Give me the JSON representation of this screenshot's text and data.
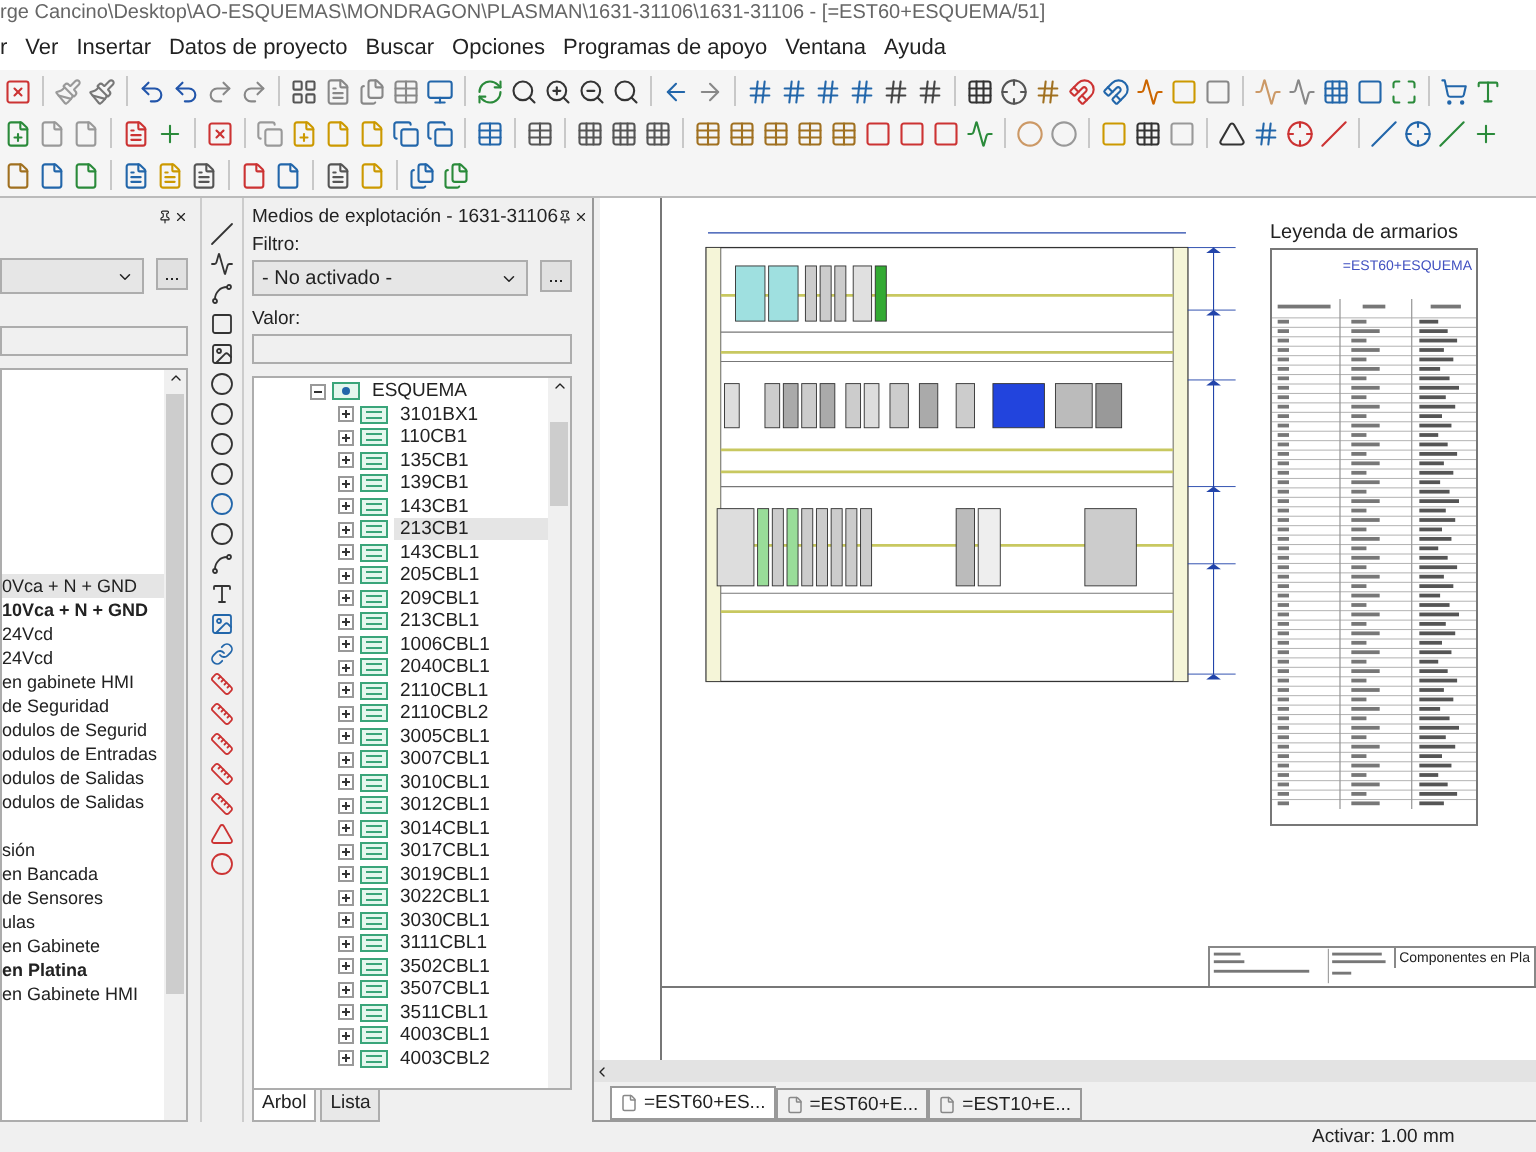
{
  "window": {
    "title": "rge Cancino\\Desktop\\AO-ESQUEMAS\\MONDRAGON\\PLASMAN\\1631-31106\\1631-31106 - [=EST60+ESQUEMA/51]"
  },
  "menu": [
    "r",
    "Ver",
    "Insertar",
    "Datos de proyecto",
    "Buscar",
    "Opciones",
    "Programas de apoyo",
    "Ventana",
    "Ayuda"
  ],
  "left_panel": {
    "browse_button": "...",
    "items": [
      {
        "label": "0Vca + N + GND",
        "emphasized": false,
        "selected": true
      },
      {
        "label": "10Vca + N + GND",
        "emphasized": true,
        "selected": false
      },
      {
        "label": "24Vcd",
        "emphasized": false,
        "selected": false
      },
      {
        "label": "24Vcd",
        "emphasized": false,
        "selected": false
      },
      {
        "label": "en gabinete HMI",
        "emphasized": false,
        "selected": false
      },
      {
        "label": "de Seguridad",
        "emphasized": false,
        "selected": false
      },
      {
        "label": "odulos de Segurid",
        "emphasized": false,
        "selected": false
      },
      {
        "label": "odulos de Entradas",
        "emphasized": false,
        "selected": false
      },
      {
        "label": "odulos de Salidas",
        "emphasized": false,
        "selected": false
      },
      {
        "label": "odulos de Salidas",
        "emphasized": false,
        "selected": false
      },
      {
        "label": "sión",
        "emphasized": false,
        "selected": false
      },
      {
        "label": "en Bancada",
        "emphasized": false,
        "selected": false
      },
      {
        "label": "de Sensores",
        "emphasized": false,
        "selected": false
      },
      {
        "label": "ulas",
        "emphasized": false,
        "selected": false
      },
      {
        "label": "en Gabinete",
        "emphasized": false,
        "selected": false
      },
      {
        "label": "en Platina",
        "emphasized": true,
        "selected": false
      },
      {
        "label": "en Gabinete HMI",
        "emphasized": false,
        "selected": false
      }
    ]
  },
  "middle_panel": {
    "title": "Medios de explotación - 1631-31106",
    "filter_label": "Filtro:",
    "filter_value": "- No activado -",
    "browse_button": "...",
    "value_label": "Valor:",
    "tree": {
      "label": "ESQUEMA",
      "expanded": true,
      "children": [
        {
          "label": "3101BX1",
          "selected": false
        },
        {
          "label": "110CB1",
          "selected": false
        },
        {
          "label": "135CB1",
          "selected": false
        },
        {
          "label": "139CB1",
          "selected": false
        },
        {
          "label": "143CB1",
          "selected": false
        },
        {
          "label": "213CB1",
          "selected": true
        },
        {
          "label": "143CBL1",
          "selected": false
        },
        {
          "label": "205CBL1",
          "selected": false
        },
        {
          "label": "209CBL1",
          "selected": false
        },
        {
          "label": "213CBL1",
          "selected": false
        },
        {
          "label": "1006CBL1",
          "selected": false
        },
        {
          "label": "2040CBL1",
          "selected": false
        },
        {
          "label": "2110CBL1",
          "selected": false
        },
        {
          "label": "2110CBL2",
          "selected": false
        },
        {
          "label": "3005CBL1",
          "selected": false
        },
        {
          "label": "3007CBL1",
          "selected": false
        },
        {
          "label": "3010CBL1",
          "selected": false
        },
        {
          "label": "3012CBL1",
          "selected": false
        },
        {
          "label": "3014CBL1",
          "selected": false
        },
        {
          "label": "3017CBL1",
          "selected": false
        },
        {
          "label": "3019CBL1",
          "selected": false
        },
        {
          "label": "3022CBL1",
          "selected": false
        },
        {
          "label": "3030CBL1",
          "selected": false
        },
        {
          "label": "3111CBL1",
          "selected": false
        },
        {
          "label": "3502CBL1",
          "selected": false
        },
        {
          "label": "3507CBL1",
          "selected": false
        },
        {
          "label": "3511CBL1",
          "selected": false
        },
        {
          "label": "4003CBL1",
          "selected": false
        },
        {
          "label": "4003CBL2",
          "selected": false
        }
      ]
    },
    "tabs": [
      {
        "label": "Arbol",
        "selected": true
      },
      {
        "label": "Lista",
        "selected": false
      }
    ]
  },
  "drawing": {
    "legend_title": "Leyenda de armarios",
    "legend_header": "=EST60+ESQUEMA",
    "title_block_text": "Componentes en Pla"
  },
  "document_tabs": [
    {
      "label": "=EST60+ES...",
      "selected": true
    },
    {
      "label": "=EST60+E...",
      "selected": false
    },
    {
      "label": "=EST10+E...",
      "selected": false
    }
  ],
  "status_bar": {
    "readout": "Activar: 1.00 mm"
  }
}
